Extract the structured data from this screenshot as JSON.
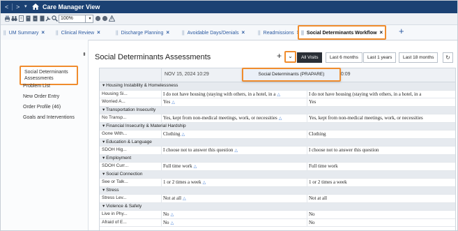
{
  "window": {
    "title": "Care Manager View",
    "nav_prev": "<",
    "nav_next": ">",
    "menu_caret": "▾",
    "home_icon": "home-icon"
  },
  "toolbar": {
    "zoom_value": "100%",
    "icons": [
      "print-icon",
      "binoculars-icon",
      "document-icon",
      "document-icon",
      "document-icon",
      "document-icon",
      "wrench-icon",
      "search-icon",
      "circle-icon",
      "circle-icon",
      "warning-icon"
    ]
  },
  "tabs": [
    {
      "label": "UM Summary",
      "close": "×"
    },
    {
      "label": "Clinical Review",
      "close": "×"
    },
    {
      "label": "Discharge Planning",
      "close": "×"
    },
    {
      "label": "Avoidable Days/Denials",
      "close": "×"
    },
    {
      "label": "Readmissions",
      "close": "×"
    },
    {
      "label": "Social Determinants Workflow",
      "close": "×",
      "active": true
    }
  ],
  "tab_add": "+",
  "tab_separator": "||",
  "leftnav": {
    "pin": "⬍",
    "items": [
      {
        "label": "Social Determinants Assessments",
        "selected": true
      },
      {
        "label": "Problem List"
      },
      {
        "label": "New Order Entry"
      },
      {
        "label": "Order Profile (46)"
      },
      {
        "label": "Goals and Interventions"
      }
    ]
  },
  "main": {
    "title": "Social Determinants Assessments",
    "add_label": "+",
    "dropdown_label": "⌄",
    "filters": [
      "All Visits",
      "Last 6 months",
      "Last 1 years",
      "Last 18 months"
    ],
    "active_filter": "All Visits",
    "refresh_label": "↻",
    "dropdown_menu_item": "Social Determinants (PRAPARE)"
  },
  "grid": {
    "col1_date": "NOV 15, 2024 10:29",
    "col2_date": "10:09",
    "rows": [
      {
        "type": "category",
        "label": "Housing Instability & Homelessness"
      },
      {
        "type": "data",
        "label": "Housing Si...",
        "v1": "I do not have housing (staying with others, in a hotel, in a",
        "v1_flag": true,
        "v2": "I do not have housing (staying with others, in a hotel, in a"
      },
      {
        "type": "data",
        "label": "Worried A...",
        "v1": "Yes",
        "v1_flag": true,
        "v2": "Yes"
      },
      {
        "type": "category",
        "label": "Transportation Insecurity"
      },
      {
        "type": "data",
        "label": "No Transp...",
        "v1": "Yes, kept from non-medical meetings, work, or necessities",
        "v1_flag": true,
        "v2": "Yes, kept from non-medical meetings, work, or necessities"
      },
      {
        "type": "category",
        "label": "Financial Insecurity & Material Hardship"
      },
      {
        "type": "data",
        "label": "Gone With...",
        "v1": "Clothing",
        "v1_flag": true,
        "v2": "Clothing"
      },
      {
        "type": "category",
        "label": "Education & Language"
      },
      {
        "type": "data",
        "label": "SDOH Hig...",
        "v1": "I choose not to answer this question",
        "v1_flag": true,
        "v2": "I choose not to answer this question"
      },
      {
        "type": "category",
        "label": "Employment"
      },
      {
        "type": "data",
        "label": "SDOH Curr...",
        "v1": "Full time work",
        "v1_flag": true,
        "v2": "Full time work"
      },
      {
        "type": "category",
        "label": "Social Connection"
      },
      {
        "type": "data",
        "label": "See or Talk...",
        "v1": "1 or 2 times a week",
        "v1_flag": true,
        "v2": "1 or 2 times a week"
      },
      {
        "type": "category",
        "label": "Stress"
      },
      {
        "type": "data",
        "label": "Stress Lev...",
        "v1": "Not at all",
        "v1_flag": true,
        "v2": "Not at all"
      },
      {
        "type": "category",
        "label": "Violence & Safety"
      },
      {
        "type": "data",
        "label": "Live in Phy...",
        "v1": "No",
        "v1_flag": true,
        "v2": "No"
      },
      {
        "type": "data",
        "label": "Afraid of E...",
        "v1": "No",
        "v1_flag": true,
        "v2": "No"
      }
    ]
  },
  "colors": {
    "titlebar": "#1b4173",
    "highlight": "#f08c2d",
    "link": "#2c5aa0",
    "flag": "#3b7ad6"
  }
}
